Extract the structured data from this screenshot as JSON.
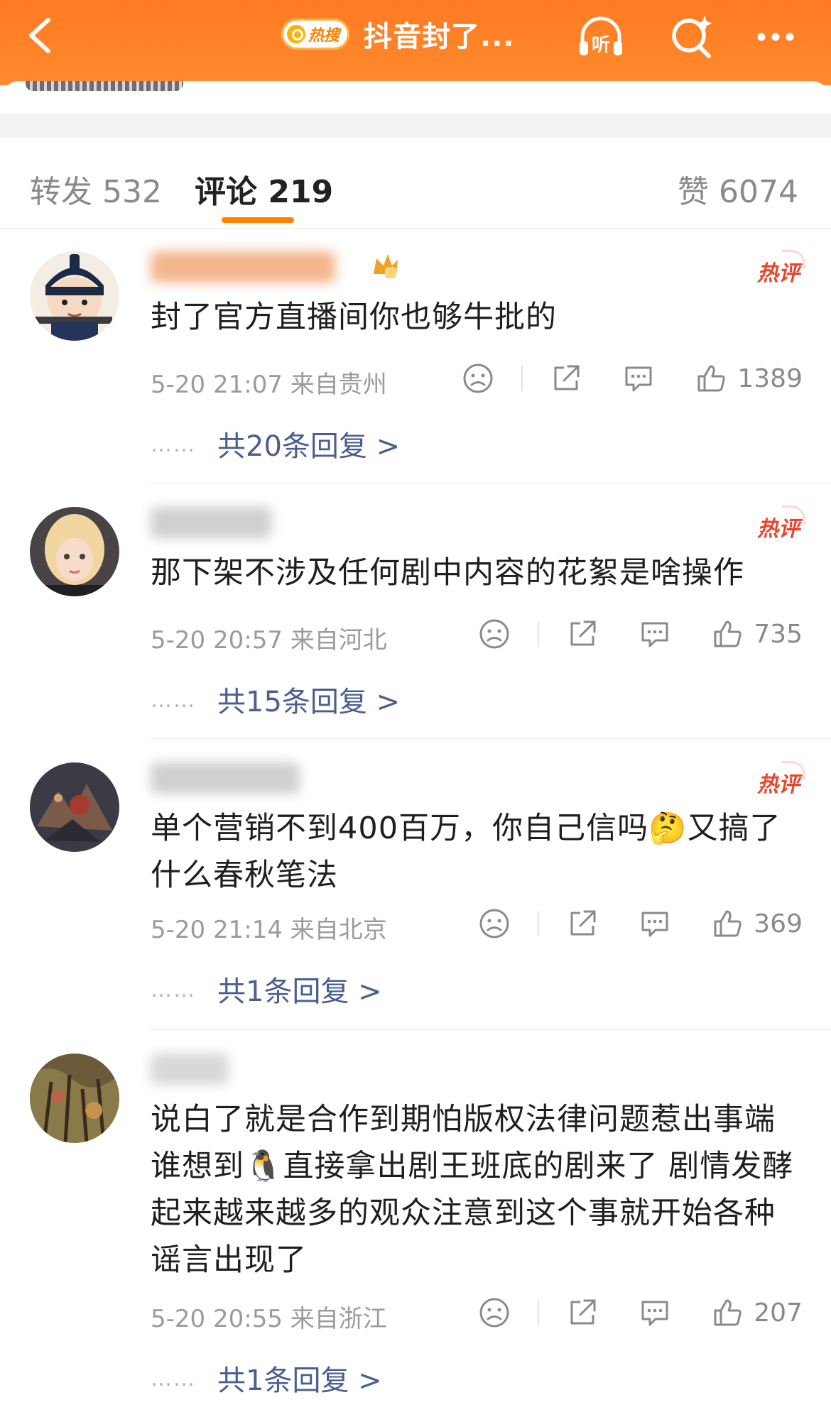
{
  "header": {
    "back_label": "back",
    "hot_badge": "热搜",
    "title": "抖音封了...",
    "listen_label": "听",
    "brand_color": "#ff8200"
  },
  "tabs": [
    {
      "label": "转发",
      "count": "532"
    },
    {
      "label": "评论",
      "count": "219"
    },
    {
      "label": "赞",
      "count": "6074"
    }
  ],
  "comments": [
    {
      "hot_tag": "热评",
      "text": "封了官方直播间你也够牛批的",
      "date": "5-20 21:07",
      "location": "来自贵州",
      "likes": "1389",
      "replies": "共20条回复 >"
    },
    {
      "hot_tag": "热评",
      "text": "那下架不涉及任何剧中内容的花絮是啥操作",
      "date": "5-20 20:57",
      "location": "来自河北",
      "likes": "735",
      "replies": "共15条回复 >"
    },
    {
      "hot_tag": "热评",
      "text": "单个营销不到400百万，你自己信吗🤔又搞了什么春秋笔法",
      "date": "5-20 21:14",
      "location": "来自北京",
      "likes": "369",
      "replies": "共1条回复 >"
    },
    {
      "hot_tag": "",
      "text": "说白了就是合作到期怕版权法律问题惹出事端 谁想到🐧直接拿出剧王班底的剧来了 剧情发酵起来越来越多的观众注意到这个事就开始各种谣言出现了",
      "date": "5-20 20:55",
      "location": "来自浙江",
      "likes": "207",
      "replies": "共1条回复 >"
    }
  ],
  "icons": {
    "back": "chevron-left-icon",
    "listen": "headphones-icon",
    "search": "search-sparkle-icon",
    "more": "more-dots-icon",
    "dislike": "frown-face-icon",
    "share": "share-icon",
    "reply": "comment-bubble-icon",
    "like": "thumbs-up-icon"
  }
}
